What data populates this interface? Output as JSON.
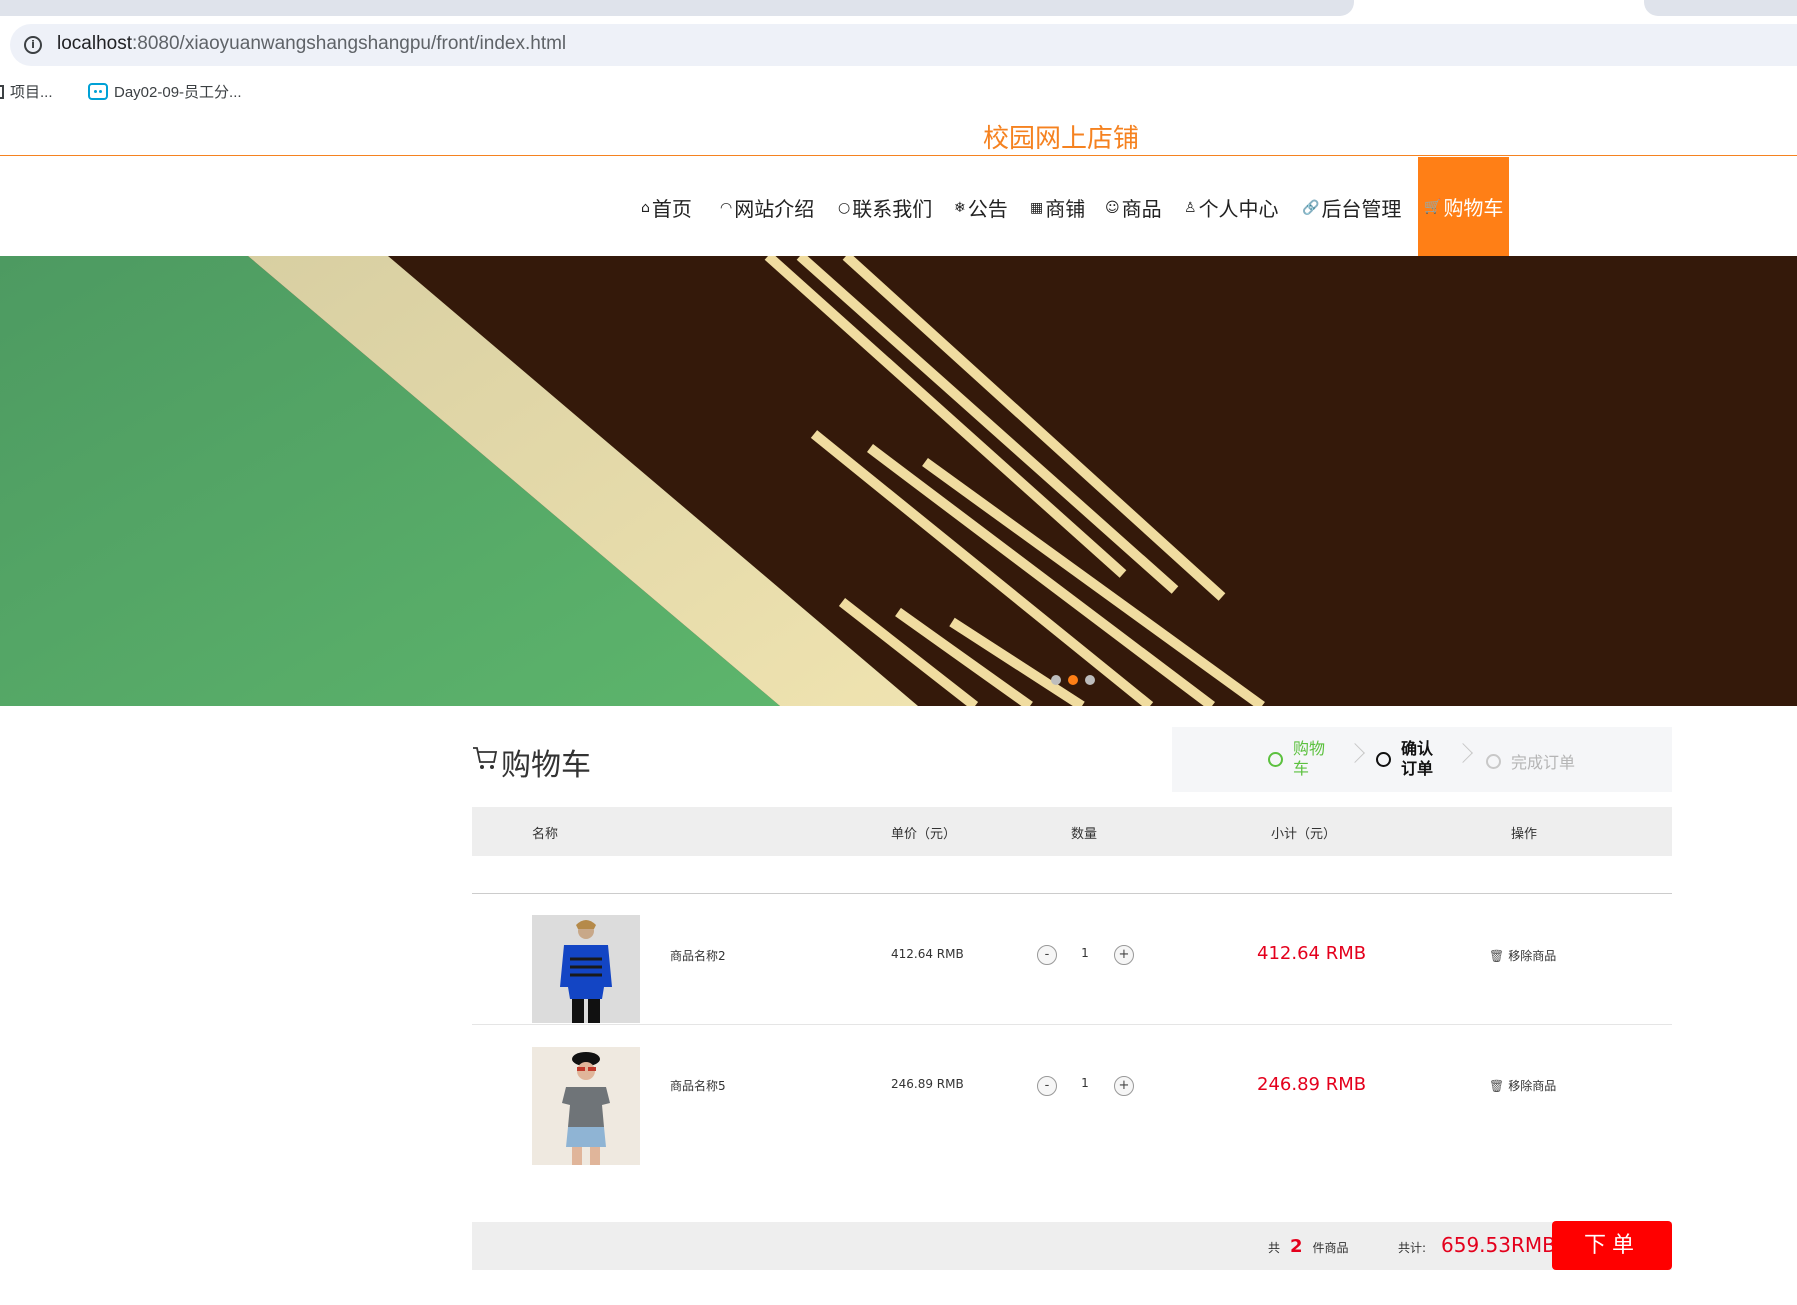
{
  "browser": {
    "url_host": "localhost",
    "url_path": ":8080/xiaoyuanwangshangshangpu/front/index.html",
    "bookmarks": [
      {
        "label": "项目...",
        "icon": "folder-icon"
      },
      {
        "label": "Day02-09-员工分...",
        "icon": "bilibili-icon"
      }
    ]
  },
  "site": {
    "title": "校园网上店铺"
  },
  "nav": {
    "items": [
      {
        "label": "首页",
        "icon": "⌂"
      },
      {
        "label": "网站介绍",
        "icon": "◠"
      },
      {
        "label": "联系我们",
        "icon": "○"
      },
      {
        "label": "公告",
        "icon": "❄"
      },
      {
        "label": "商铺",
        "icon": "▦"
      },
      {
        "label": "商品",
        "icon": "☺"
      },
      {
        "label": "个人中心",
        "icon": "♙"
      },
      {
        "label": "后台管理",
        "icon": "🔗"
      },
      {
        "label": "购物车",
        "icon": "🛒",
        "active": true
      }
    ],
    "accent_color": "#ff7f16"
  },
  "banner": {
    "slides": 3,
    "active_slide": 2
  },
  "cart": {
    "title": "购物车",
    "steps": [
      {
        "label": "购物车",
        "state": "done"
      },
      {
        "label": "确认订单",
        "state": "current"
      },
      {
        "label": "完成订单",
        "state": "todo"
      }
    ],
    "columns": {
      "name": "名称",
      "price": "单价（元）",
      "qty": "数量",
      "subtotal": "小计（元）",
      "op": "操作"
    },
    "items": [
      {
        "name": "商品名称2",
        "price": "412.64 RMB",
        "qty": "1",
        "minus": "-",
        "plus": "+",
        "subtotal": "412.64 RMB",
        "remove": "移除商品"
      },
      {
        "name": "商品名称5",
        "price": "246.89 RMB",
        "qty": "1",
        "minus": "-",
        "plus": "+",
        "subtotal": "246.89 RMB",
        "remove": "移除商品"
      }
    ],
    "summary": {
      "count_prefix": "共",
      "count": "2",
      "count_suffix": "件商品",
      "total_label": "共计:",
      "total": "659.53RMB"
    },
    "order_button": "下单",
    "price_color": "#e4001c"
  }
}
